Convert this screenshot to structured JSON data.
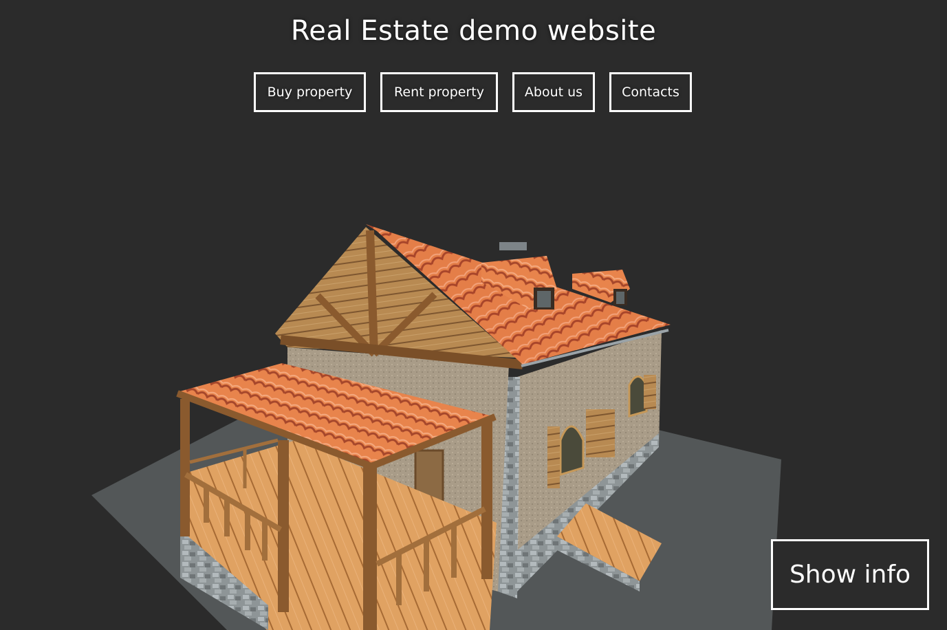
{
  "header": {
    "title": "Real Estate demo website"
  },
  "nav": {
    "items": [
      {
        "label": "Buy property"
      },
      {
        "label": "Rent property"
      },
      {
        "label": "About us"
      },
      {
        "label": "Contacts"
      }
    ]
  },
  "info_button": {
    "label": "Show info"
  },
  "colors": {
    "background": "#2b2b2b",
    "ground": "#535758",
    "roof_tile": "#e07a45",
    "wood": "#9a6a3c",
    "wall": "#a89a86",
    "stone": "#8f9699",
    "deck": "#d99a5a"
  }
}
